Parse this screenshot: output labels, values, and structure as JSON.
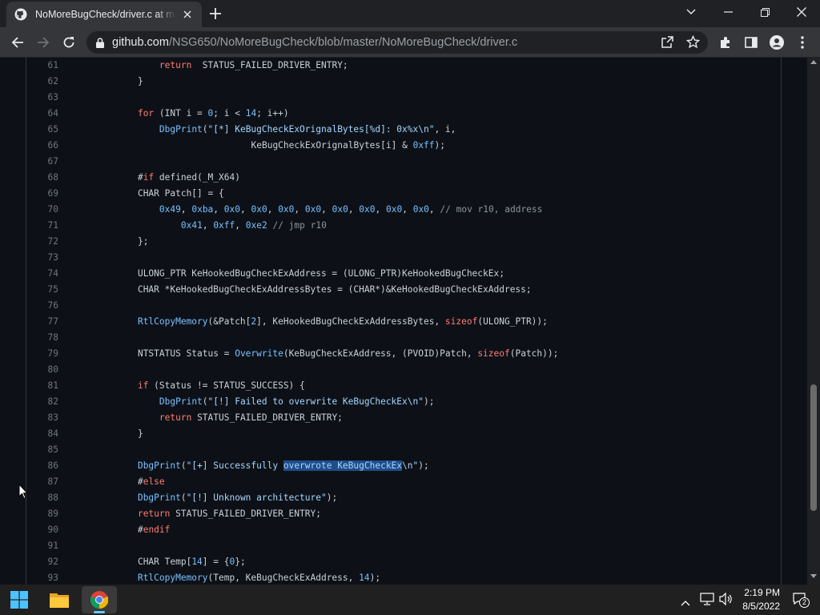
{
  "browser": {
    "tab_title": "NoMoreBugCheck/driver.c at master",
    "url_host": "github.com",
    "url_path": "/NSG650/NoMoreBugCheck/blob/master/NoMoreBugCheck/driver.c"
  },
  "code": {
    "lines": [
      {
        "n": "61",
        "indent": 8,
        "tokens": [
          [
            "k",
            "return"
          ],
          [
            "",
            "  STATUS_FAILED_DRIVER_ENTRY;"
          ]
        ]
      },
      {
        "n": "62",
        "indent": 4,
        "tokens": [
          [
            "",
            "}"
          ]
        ]
      },
      {
        "n": "63",
        "indent": 0,
        "tokens": []
      },
      {
        "n": "64",
        "indent": 4,
        "tokens": [
          [
            "k",
            "for"
          ],
          [
            "",
            " (INT i = "
          ],
          [
            "f",
            "0"
          ],
          [
            "",
            "; i < "
          ],
          [
            "f",
            "14"
          ],
          [
            "",
            "; i++)"
          ]
        ]
      },
      {
        "n": "65",
        "indent": 8,
        "tokens": [
          [
            "f",
            "DbgPrint"
          ],
          [
            "",
            "("
          ],
          [
            "s",
            "\"[*] KeBugCheckExOrignalBytes[%d]: 0x%x\\n\""
          ],
          [
            "",
            ", i,"
          ]
        ]
      },
      {
        "n": "66",
        "indent": 25,
        "tokens": [
          [
            "",
            "KeBugCheckExOrignalBytes[i] & "
          ],
          [
            "f",
            "0xff"
          ],
          [
            "",
            ");"
          ]
        ]
      },
      {
        "n": "67",
        "indent": 0,
        "tokens": []
      },
      {
        "n": "68",
        "indent": 4,
        "tokens": [
          [
            "",
            "#"
          ],
          [
            "k",
            "if"
          ],
          [
            "",
            " defined(_M_X64)"
          ]
        ]
      },
      {
        "n": "69",
        "indent": 4,
        "tokens": [
          [
            "",
            "CHAR Patch[] = {"
          ]
        ]
      },
      {
        "n": "70",
        "indent": 8,
        "tokens": [
          [
            "f",
            "0x49"
          ],
          [
            "",
            ", "
          ],
          [
            "f",
            "0xba"
          ],
          [
            "",
            ", "
          ],
          [
            "f",
            "0x0"
          ],
          [
            "",
            ", "
          ],
          [
            "f",
            "0x0"
          ],
          [
            "",
            ", "
          ],
          [
            "f",
            "0x0"
          ],
          [
            "",
            ", "
          ],
          [
            "f",
            "0x0"
          ],
          [
            "",
            ", "
          ],
          [
            "f",
            "0x0"
          ],
          [
            "",
            ", "
          ],
          [
            "f",
            "0x0"
          ],
          [
            "",
            ", "
          ],
          [
            "f",
            "0x0"
          ],
          [
            "",
            ", "
          ],
          [
            "f",
            "0x0"
          ],
          [
            "",
            ", "
          ],
          [
            "c",
            "// mov r10, address"
          ]
        ]
      },
      {
        "n": "71",
        "indent": 12,
        "tokens": [
          [
            "f",
            "0x41"
          ],
          [
            "",
            ", "
          ],
          [
            "f",
            "0xff"
          ],
          [
            "",
            ", "
          ],
          [
            "f",
            "0xe2"
          ],
          [
            "",
            " "
          ],
          [
            "c",
            "// jmp r10"
          ]
        ]
      },
      {
        "n": "72",
        "indent": 4,
        "tokens": [
          [
            "",
            "};"
          ]
        ]
      },
      {
        "n": "73",
        "indent": 0,
        "tokens": []
      },
      {
        "n": "74",
        "indent": 4,
        "tokens": [
          [
            "",
            "ULONG_PTR KeHookedBugCheckExAddress = (ULONG_PTR)KeHookedBugCheckEx;"
          ]
        ]
      },
      {
        "n": "75",
        "indent": 4,
        "tokens": [
          [
            "",
            "CHAR *KeHookedBugCheckExAddressBytes = (CHAR*)&KeHookedBugCheckExAddress;"
          ]
        ]
      },
      {
        "n": "76",
        "indent": 0,
        "tokens": []
      },
      {
        "n": "77",
        "indent": 4,
        "tokens": [
          [
            "f",
            "RtlCopyMemory"
          ],
          [
            "",
            "(&Patch["
          ],
          [
            "f",
            "2"
          ],
          [
            "",
            "], KeHookedBugCheckExAddressBytes, "
          ],
          [
            "k",
            "sizeof"
          ],
          [
            "",
            "(ULONG_PTR));"
          ]
        ]
      },
      {
        "n": "78",
        "indent": 0,
        "tokens": []
      },
      {
        "n": "79",
        "indent": 4,
        "tokens": [
          [
            "",
            "NTSTATUS Status = "
          ],
          [
            "f",
            "Overwrite"
          ],
          [
            "",
            "(KeBugCheckExAddress, (PVOID)Patch, "
          ],
          [
            "k",
            "sizeof"
          ],
          [
            "",
            "(Patch));"
          ]
        ]
      },
      {
        "n": "80",
        "indent": 0,
        "tokens": []
      },
      {
        "n": "81",
        "indent": 4,
        "tokens": [
          [
            "k",
            "if"
          ],
          [
            "",
            " (Status != STATUS_SUCCESS) {"
          ]
        ]
      },
      {
        "n": "82",
        "indent": 8,
        "tokens": [
          [
            "f",
            "DbgPrint"
          ],
          [
            "",
            "("
          ],
          [
            "s",
            "\"[!] Failed to overwrite KeBugCheckEx\\n\""
          ],
          [
            "",
            ");"
          ]
        ]
      },
      {
        "n": "83",
        "indent": 8,
        "tokens": [
          [
            "k",
            "return"
          ],
          [
            "",
            " STATUS_FAILED_DRIVER_ENTRY;"
          ]
        ]
      },
      {
        "n": "84",
        "indent": 4,
        "tokens": [
          [
            "",
            "}"
          ]
        ]
      },
      {
        "n": "85",
        "indent": 0,
        "tokens": []
      },
      {
        "n": "86",
        "indent": 4,
        "tokens": [
          [
            "f",
            "DbgPrint"
          ],
          [
            "",
            "("
          ],
          [
            "s",
            "\"[+] Successfully "
          ],
          [
            "hl",
            "overwrote KeBugCheckEx"
          ],
          [
            "s",
            "\\n\""
          ],
          [
            "",
            ");"
          ]
        ]
      },
      {
        "n": "87",
        "indent": 4,
        "tokens": [
          [
            "",
            "#"
          ],
          [
            "k",
            "else"
          ]
        ]
      },
      {
        "n": "88",
        "indent": 4,
        "tokens": [
          [
            "f",
            "DbgPrint"
          ],
          [
            "",
            "("
          ],
          [
            "s",
            "\"[!] Unknown architecture\""
          ],
          [
            "",
            ");"
          ]
        ]
      },
      {
        "n": "89",
        "indent": 4,
        "tokens": [
          [
            "k",
            "return"
          ],
          [
            "",
            " STATUS_FAILED_DRIVER_ENTRY;"
          ]
        ]
      },
      {
        "n": "90",
        "indent": 4,
        "tokens": [
          [
            "",
            "#"
          ],
          [
            "k",
            "endif"
          ]
        ]
      },
      {
        "n": "91",
        "indent": 0,
        "tokens": []
      },
      {
        "n": "92",
        "indent": 4,
        "tokens": [
          [
            "",
            "CHAR Temp["
          ],
          [
            "f",
            "14"
          ],
          [
            "",
            "] = {"
          ],
          [
            "f",
            "0"
          ],
          [
            "",
            "};"
          ]
        ]
      },
      {
        "n": "93",
        "indent": 4,
        "tokens": [
          [
            "f",
            "RtlCopyMemory"
          ],
          [
            "",
            "(Temp, KeBugCheckExAddress, "
          ],
          [
            "f",
            "14"
          ],
          [
            "",
            ");"
          ]
        ]
      }
    ]
  },
  "taskbar": {
    "time": "2:19 PM",
    "date": "8/5/2022",
    "notification_count": "2"
  },
  "colors": {
    "keyword": "#ff7b72",
    "function": "#79c0ff",
    "string": "#a5d6ff",
    "comment": "#8b949e",
    "selection": "#1f4d8a"
  }
}
